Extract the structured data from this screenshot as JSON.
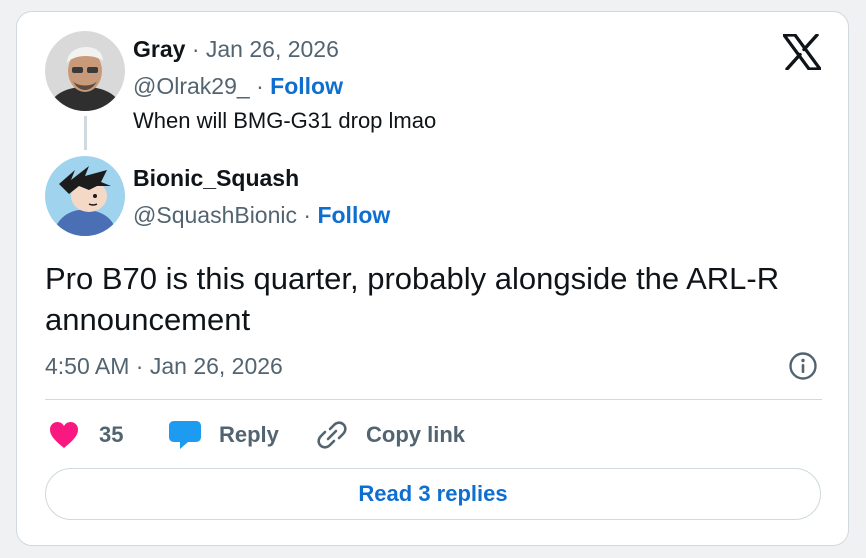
{
  "parent": {
    "name": "Gray",
    "separator": "·",
    "date": "Jan 26, 2026",
    "handle": "@Olrak29_",
    "follow_sep": "·",
    "follow": "Follow",
    "text": "When will BMG-G31 drop lmao"
  },
  "reply": {
    "name": "Bionic_Squash",
    "handle": "@SquashBionic",
    "follow_sep": "·",
    "follow": "Follow",
    "text": "Pro B70 is this quarter, probably alongside the ARL-R announcement",
    "time": "4:50 AM",
    "time_sep": "·",
    "date": "Jan 26, 2026"
  },
  "actions": {
    "likes": "35",
    "reply_label": "Reply",
    "copy_label": "Copy link"
  },
  "read_replies": "Read 3 replies",
  "icons": {
    "logo": "x-logo-icon",
    "info": "info-icon",
    "like": "heart-icon",
    "reply": "speech-bubble-icon",
    "copy": "link-icon"
  },
  "colors": {
    "link": "#0f6fd1",
    "heart": "#f91880",
    "reply_bubble": "#1d9bf0",
    "muted": "#536471"
  }
}
